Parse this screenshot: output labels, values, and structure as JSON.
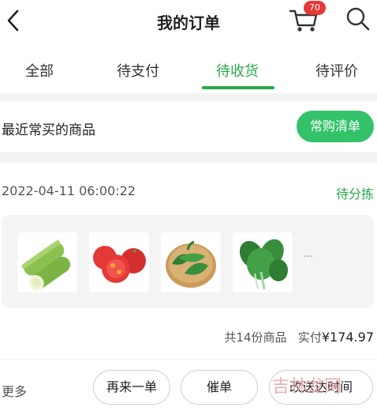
{
  "header": {
    "title": "我的订单",
    "cart_badge": "70"
  },
  "tabs": [
    {
      "label": "全部",
      "active": false
    },
    {
      "label": "待支付",
      "active": false
    },
    {
      "label": "待收货",
      "active": true
    },
    {
      "label": "待评价",
      "active": false
    }
  ],
  "recent": {
    "label": "最近常买的商品",
    "button_label": "常购清单"
  },
  "order": {
    "time": "2022-04-11 06:00:22",
    "status": "待分拣",
    "items": [
      {
        "icon": "zucchini-image"
      },
      {
        "icon": "tomato-image"
      },
      {
        "icon": "green-pepper-image"
      },
      {
        "icon": "spinach-image"
      }
    ],
    "more_dots": "···",
    "summary_count": "共14份商品",
    "summary_paid_label": "实付",
    "summary_paid_amount": "¥174.97",
    "more_link": "更多",
    "actions": [
      {
        "label": "再来一单"
      },
      {
        "label": "催单"
      },
      {
        "label": "改送达时间"
      }
    ]
  },
  "watermark": "吉林龙网",
  "colors": {
    "accent": "#2aa84a",
    "button_green": "#33c26a",
    "badge_red": "#e53935"
  }
}
